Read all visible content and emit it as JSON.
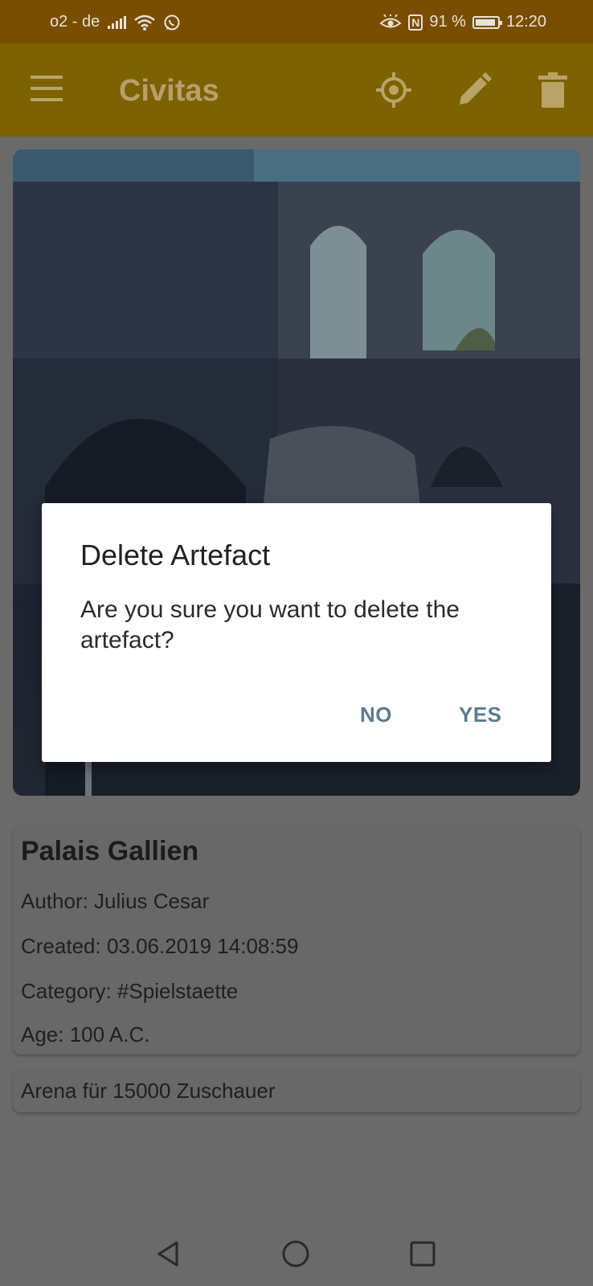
{
  "status_bar": {
    "carrier": "o2 - de",
    "battery_percent": "91 %",
    "time": "12:20",
    "icons": [
      "signal-icon",
      "wifi-icon",
      "whatsapp-icon",
      "eye-comfort-icon",
      "nfc-icon",
      "battery-icon"
    ]
  },
  "app_bar": {
    "title": "Civitas",
    "actions": [
      "menu-icon",
      "locate-icon",
      "edit-icon",
      "delete-icon"
    ]
  },
  "artefact": {
    "name": "Palais Gallien",
    "author": "Author: Julius Cesar",
    "created": "Created: 03.06.2019 14:08:59",
    "category": "Category: #Spielstaette",
    "age": "Age: 100 A.C.",
    "description": "Arena für 15000 Zuschauer"
  },
  "dialog": {
    "title": "Delete Artefact",
    "message": "Are you sure you want to delete the artefact?",
    "negative_label": "NO",
    "positive_label": "YES"
  },
  "colors": {
    "status_bar": "#7a4e00",
    "app_bar": "#7d6200",
    "dim_background": "#6a6a6a",
    "dialog_button": "#5d7b8f"
  }
}
